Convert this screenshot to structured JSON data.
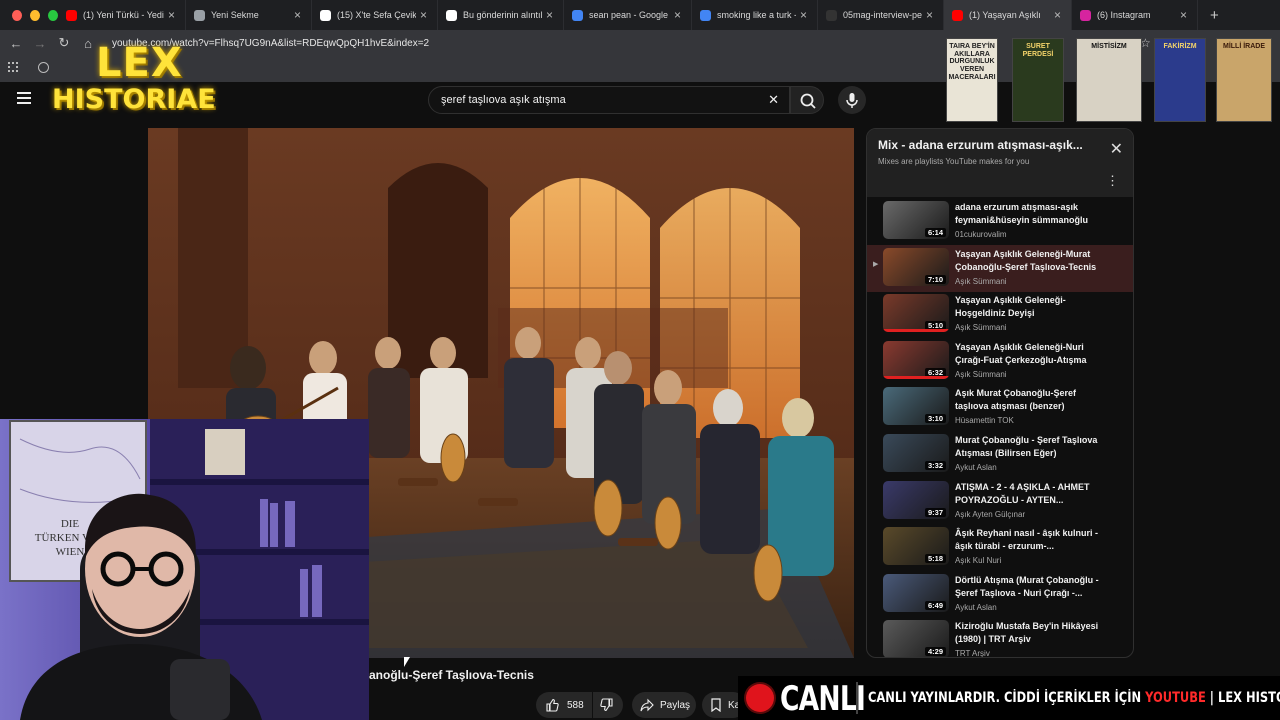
{
  "browser": {
    "tabs": [
      {
        "title": "(1) Yeni Türkü - Yedi",
        "icon": "youtube-icon",
        "color": "#ff0000"
      },
      {
        "title": "Yeni Sekme",
        "icon": "chrome-icon",
        "color": "#9aa0a6"
      },
      {
        "title": "(15) X'te Sefa Çevik",
        "icon": "x-icon",
        "color": "#ffffff"
      },
      {
        "title": "Bu gönderinin alıntıla",
        "icon": "x-icon",
        "color": "#ffffff"
      },
      {
        "title": "sean pean - Google",
        "icon": "google-icon",
        "color": "#4285f4"
      },
      {
        "title": "smoking like a turk -",
        "icon": "google-icon",
        "color": "#4285f4"
      },
      {
        "title": "05mag-interview-pe",
        "icon": "page-icon",
        "color": "#333333"
      },
      {
        "title": "(1) Yaşayan Aşıklı",
        "icon": "youtube-icon",
        "color": "#ff0000"
      },
      {
        "title": "(6) Instagram",
        "icon": "instagram-icon",
        "color": "#d6249f"
      }
    ],
    "new_tab": "+",
    "url": "youtube.com/watch?v=Flhsq7UG9nA&list=RDEqwQpQH1hvE&index=2"
  },
  "overlay": {
    "logo_line1": "LEX",
    "logo_line2": "HISTORIAE",
    "books": [
      "TAIRA BEY'İN AKILLARA DURGUNLUK VEREN MACERALARI",
      "SURET PERDESİ",
      "MİSTİSİZM",
      "FAKİRİZM",
      "MİLLİ İRADE"
    ]
  },
  "search": {
    "query": "şeref taşlıova aşık atışma",
    "clear": "✕"
  },
  "playlist": {
    "title": "Mix - adana erzurum atışması-aşık...",
    "subtitle": "Mixes are playlists YouTube makes for you",
    "close": "✕",
    "more": "⋮",
    "now_playing_indicator": "▶",
    "items": [
      {
        "title": "adana erzurum atışması-aşık feymani&hüseyin sümmanoğlu",
        "channel": "01cukurovalim",
        "duration": "6:14",
        "thumb": "#6a6a6a",
        "progress": 0
      },
      {
        "title": "Yaşayan Aşıklık Geleneği-Murat Çobanoğlu-Şeref Taşlıova-Tecnis",
        "channel": "Aşık Sümmani",
        "duration": "7:10",
        "thumb": "#8a4a2a",
        "progress": 0
      },
      {
        "title": "Yaşayan Aşıklık Geleneği-Hoşgeldiniz Deyişi",
        "channel": "Aşık Sümmani",
        "duration": "5:10",
        "thumb": "#7a3a2a",
        "progress": 1.0
      },
      {
        "title": "Yaşayan Aşıklık Geleneği-Nuri Çırağı-Fuat Çerkezoğlu-Atışma",
        "channel": "Aşık Sümmani",
        "duration": "6:32",
        "thumb": "#8a3a30",
        "progress": 1.0
      },
      {
        "title": "Aşık Murat Çobanoğlu-Şeref taşlıova atışması (benzer)",
        "channel": "Hüsamettin TOK",
        "duration": "3:10",
        "thumb": "#4a6a7a",
        "progress": 0
      },
      {
        "title": "Murat Çobanoğlu - Şeref Taşlıova Atışması (Bilirsen Eğer)",
        "channel": "Aykut Aslan",
        "duration": "3:32",
        "thumb": "#3a4a5a",
        "progress": 0
      },
      {
        "title": "ATIŞMA - 2 - 4 AŞIKLA - AHMET POYRAZOĞLU - AYTEN...",
        "channel": "Aşık Ayten Gülçınar",
        "duration": "9:37",
        "thumb": "#3a3a6a",
        "progress": 0
      },
      {
        "title": "Âşık Reyhani nasıl - âşık kulnuri - âşık türabi - erzurum-...",
        "channel": "Aşık Kul Nuri",
        "duration": "5:18",
        "thumb": "#5a4a2a",
        "progress": 0
      },
      {
        "title": "Dörtlü Atışma (Murat Çobanoğlu - Şeref Taşlıova - Nuri Çırağı -...",
        "channel": "Aykut Aslan",
        "duration": "6:49",
        "thumb": "#4a5a7a",
        "progress": 0
      },
      {
        "title": "Kiziroğlu Mustafa Bey'in Hikâyesi (1980) | TRT Arşiv",
        "channel": "TRT Arşiv",
        "duration": "4:29",
        "thumb": "#5a5a5a",
        "progress": 0
      }
    ]
  },
  "video": {
    "title": "anoğlu-Şeref Taşlıova-Tecnis",
    "likes": "588",
    "share": "Paylaş",
    "save": "Ka"
  },
  "live": {
    "badge": "CANLI",
    "ticker_a": "CANLI YAYINLARDIR. CİDDİ İÇERİKLER İÇİN ",
    "ticker_yt": "YOUTUBE",
    "ticker_b": " | LEX HISTORIAE KA"
  }
}
